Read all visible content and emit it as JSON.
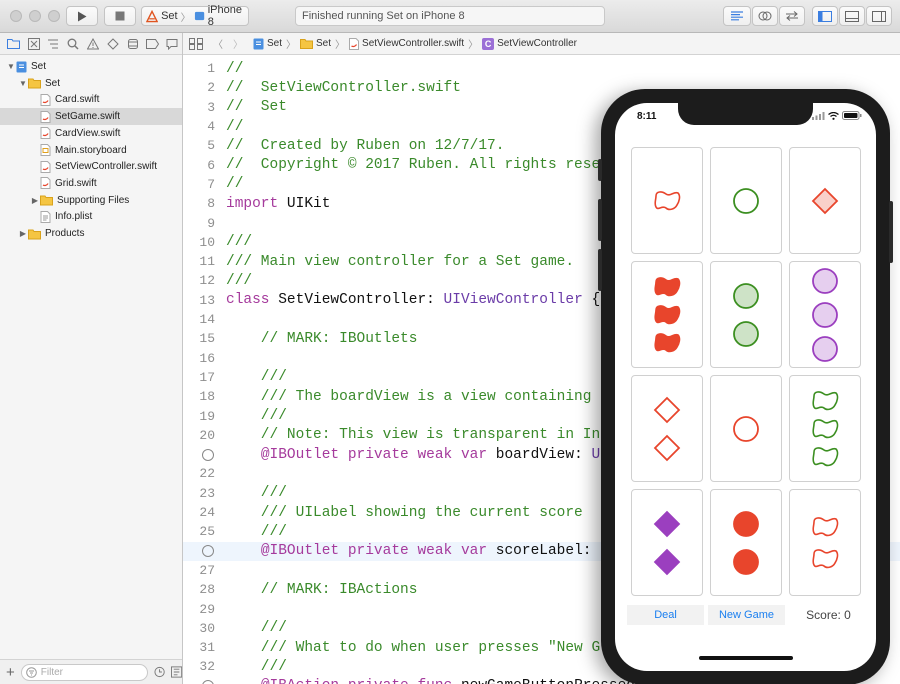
{
  "toolbar": {
    "scheme_project": "Set",
    "scheme_device": "iPhone 8",
    "status_text": "Finished running Set on iPhone 8"
  },
  "navigator": {
    "items": [
      {
        "label": "Set",
        "kind": "project",
        "depth": 0,
        "open": true
      },
      {
        "label": "Set",
        "kind": "folder",
        "depth": 1,
        "open": true
      },
      {
        "label": "Card.swift",
        "kind": "swift",
        "depth": 2
      },
      {
        "label": "SetGame.swift",
        "kind": "swift",
        "depth": 2,
        "selected": true
      },
      {
        "label": "CardView.swift",
        "kind": "swift",
        "depth": 2
      },
      {
        "label": "Main.storyboard",
        "kind": "storyboard",
        "depth": 2
      },
      {
        "label": "SetViewController.swift",
        "kind": "swift",
        "depth": 2
      },
      {
        "label": "Grid.swift",
        "kind": "swift",
        "depth": 2
      },
      {
        "label": "Supporting Files",
        "kind": "folder",
        "depth": 2,
        "open": false
      },
      {
        "label": "Info.plist",
        "kind": "plist",
        "depth": 2
      },
      {
        "label": "Products",
        "kind": "folder",
        "depth": 1,
        "open": false
      }
    ],
    "filter_placeholder": "Filter"
  },
  "jumpbar": {
    "crumbs": [
      "Set",
      "Set",
      "SetViewController.swift",
      "SetViewController"
    ]
  },
  "editor": {
    "lines": [
      {
        "n": "1",
        "segs": [
          [
            "c",
            "//"
          ]
        ]
      },
      {
        "n": "2",
        "segs": [
          [
            "c",
            "//  SetViewController.swift"
          ]
        ]
      },
      {
        "n": "3",
        "segs": [
          [
            "c",
            "//  Set"
          ]
        ]
      },
      {
        "n": "4",
        "segs": [
          [
            "c",
            "//"
          ]
        ]
      },
      {
        "n": "5",
        "segs": [
          [
            "c",
            "//  Created by Ruben on 12/7/17."
          ]
        ]
      },
      {
        "n": "6",
        "segs": [
          [
            "c",
            "//  Copyright © 2017 Ruben. All rights rese"
          ]
        ]
      },
      {
        "n": "7",
        "segs": [
          [
            "c",
            "//"
          ]
        ]
      },
      {
        "n": "8",
        "segs": [
          [
            "k",
            "import"
          ],
          [
            "p",
            " UIKit"
          ]
        ]
      },
      {
        "n": "9",
        "segs": []
      },
      {
        "n": "10",
        "segs": [
          [
            "c",
            "///"
          ]
        ]
      },
      {
        "n": "11",
        "segs": [
          [
            "c",
            "/// Main view controller for a Set game."
          ]
        ]
      },
      {
        "n": "12",
        "segs": [
          [
            "c",
            "///"
          ]
        ]
      },
      {
        "n": "13",
        "segs": [
          [
            "k",
            "class"
          ],
          [
            "p",
            " SetViewController: "
          ],
          [
            "t",
            "UIViewController"
          ],
          [
            "p",
            " {"
          ]
        ]
      },
      {
        "n": "14",
        "segs": []
      },
      {
        "n": "15",
        "segs": [
          [
            "c",
            "    // MARK: IBOutlets"
          ]
        ]
      },
      {
        "n": "16",
        "segs": []
      },
      {
        "n": "17",
        "segs": [
          [
            "c",
            "    ///"
          ]
        ]
      },
      {
        "n": "18",
        "segs": [
          [
            "c",
            "    /// The boardView is a view containing"
          ]
        ]
      },
      {
        "n": "19",
        "segs": [
          [
            "c",
            "    ///"
          ]
        ]
      },
      {
        "n": "20",
        "segs": [
          [
            "c",
            "    // Note: This view is transparent in In"
          ]
        ]
      },
      {
        "n": "",
        "bp": true,
        "segs": [
          [
            "p",
            "    "
          ],
          [
            "k",
            "@IBOutlet private weak var"
          ],
          [
            "p",
            " boardView: "
          ],
          [
            "t",
            "U"
          ]
        ]
      },
      {
        "n": "22",
        "segs": []
      },
      {
        "n": "23",
        "segs": [
          [
            "c",
            "    ///"
          ]
        ]
      },
      {
        "n": "24",
        "segs": [
          [
            "c",
            "    /// UILabel showing the current score"
          ]
        ]
      },
      {
        "n": "25",
        "segs": [
          [
            "c",
            "    ///"
          ]
        ]
      },
      {
        "n": "",
        "bp": true,
        "hl": true,
        "segs": [
          [
            "p",
            "    "
          ],
          [
            "k",
            "@IBOutlet private weak var"
          ],
          [
            "p",
            " scoreLabel: "
          ]
        ]
      },
      {
        "n": "27",
        "segs": []
      },
      {
        "n": "28",
        "segs": [
          [
            "c",
            "    // MARK: IBActions"
          ]
        ]
      },
      {
        "n": "29",
        "segs": []
      },
      {
        "n": "30",
        "segs": [
          [
            "c",
            "    ///"
          ]
        ]
      },
      {
        "n": "31",
        "segs": [
          [
            "c",
            "    /// What to do when user presses \"New G"
          ]
        ]
      },
      {
        "n": "32",
        "segs": [
          [
            "c",
            "    ///"
          ]
        ]
      },
      {
        "n": "",
        "bp": true,
        "segs": [
          [
            "p",
            "    "
          ],
          [
            "k",
            "@IBAction private func"
          ],
          [
            "p",
            " newGameButtonPressed() {"
          ]
        ]
      }
    ]
  },
  "simulator": {
    "time": "8:11",
    "deal_label": "Deal",
    "new_game_label": "New Game",
    "score_text": "Score: 0",
    "cards": [
      {
        "shape": "squiggle",
        "count": 1,
        "color": "#e8452c",
        "fill": "open"
      },
      {
        "shape": "oval",
        "count": 1,
        "color": "#3c8f21",
        "fill": "open"
      },
      {
        "shape": "diamond",
        "count": 1,
        "color": "#e8452c",
        "fill": "striped"
      },
      {
        "shape": "squiggle",
        "count": 3,
        "color": "#e8452c",
        "fill": "solid"
      },
      {
        "shape": "oval",
        "count": 2,
        "color": "#3c8f21",
        "fill": "striped"
      },
      {
        "shape": "oval",
        "count": 3,
        "color": "#9b3fbf",
        "fill": "striped"
      },
      {
        "shape": "diamond",
        "count": 2,
        "color": "#e8452c",
        "fill": "open"
      },
      {
        "shape": "oval",
        "count": 1,
        "color": "#e8452c",
        "fill": "open"
      },
      {
        "shape": "squiggle",
        "count": 3,
        "color": "#3c8f21",
        "fill": "open"
      },
      {
        "shape": "diamond",
        "count": 2,
        "color": "#9b3fbf",
        "fill": "solid"
      },
      {
        "shape": "oval",
        "count": 2,
        "color": "#e8452c",
        "fill": "solid"
      },
      {
        "shape": "squiggle",
        "count": 2,
        "color": "#e8452c",
        "fill": "open"
      }
    ]
  }
}
